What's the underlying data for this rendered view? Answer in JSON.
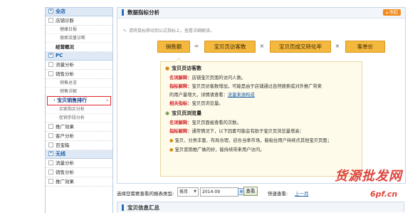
{
  "sidebar": {
    "sections": [
      {
        "title": "全店",
        "items": [
          {
            "label": "店铺诊断",
            "subs": [
              "健康日报",
              "搜索流量诊断"
            ]
          },
          {
            "label": "经营概况",
            "strong": true
          }
        ]
      },
      {
        "title": "PC",
        "items": [
          {
            "label": "流量分析"
          },
          {
            "label": "销售分析",
            "subs": [
              "销售总览",
              "销售详解"
            ]
          }
        ]
      }
    ],
    "active_item": "宝贝销售排行",
    "after_active": [
      "买家购买分析",
      "促销手段分析"
    ],
    "more_items": [
      "推广效果",
      "客户分析",
      "百宝箱"
    ],
    "wireless_title": "无线",
    "wireless_items": [
      "流量分析",
      "销售分析",
      "推广效果"
    ]
  },
  "panel": {
    "title": "数据指标分析",
    "collapse_label": "收起",
    "hint": "请将鼠标移动到公式指标上，查看详细解读。",
    "formula": {
      "sales": "销售额",
      "equals": "=",
      "visitors": "宝贝页访客数",
      "times": "×",
      "conversion": "宝贝页成交转化率",
      "aov": "客单价"
    },
    "detail": {
      "t1": "宝贝页访客数",
      "def1_label": "名词解释：",
      "def1": "店铺宝贝页面的访问人数。",
      "exp1_label": "指标解释：",
      "exp1a": "宝贝页访客数增加，可能是由于店铺通过自然搜索或对外推广带来",
      "exp1b_pre": "的用户量增大，详情请查看：",
      "exp1b_link": "流量来源构成",
      "rel1_label": "相关指标：",
      "rel1": "宝贝页浏览量。",
      "t2": "宝贝页浏览量",
      "def2_label": "名词解释：",
      "def2": "宝贝页面被查看的次数。",
      "exp2_label": "指标解释：",
      "exp2": "通常情况下，以下因素可能会有助于宝贝页浏览量增高：",
      "b1": "宝贝、分类丰富、布局合理，迎合当季市场，能粘住用户持续点其他宝贝页面；",
      "b2": "宝贝营销推广做的好，能持续带来用户访问。"
    }
  },
  "query": {
    "label": "选择您需要查看的报表类型:",
    "period": "按月",
    "date": "2014-09",
    "button": "查看",
    "fast_label": "快速查看:",
    "last_month": "上一月"
  },
  "summary_title": "宝贝信息汇总",
  "watermark": {
    "text": "货源批发网",
    "url": "6pf.cn"
  }
}
